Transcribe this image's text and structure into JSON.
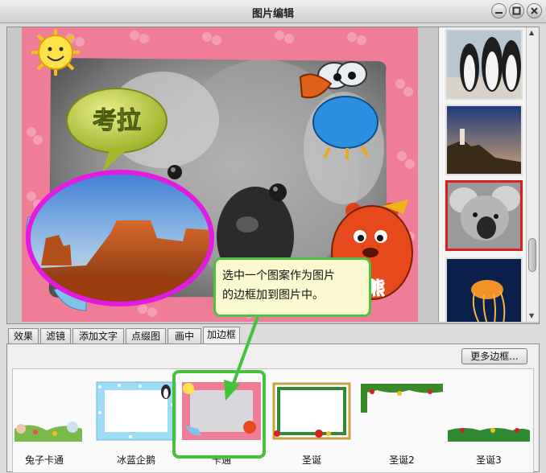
{
  "window": {
    "title": "图片编辑"
  },
  "preview": {
    "speech_text": "考拉",
    "badge_text": "熊"
  },
  "tabs": [
    {
      "label": "效果"
    },
    {
      "label": "滤镜"
    },
    {
      "label": "添加文字"
    },
    {
      "label": "点缀图"
    },
    {
      "label": "画中画"
    },
    {
      "label": "加边框"
    }
  ],
  "active_tab": "加边框",
  "panel": {
    "more_frames_label": "更多边框..."
  },
  "frames": [
    {
      "label": "兔子卡通"
    },
    {
      "label": "冰蓝企鹅"
    },
    {
      "label": "卡通"
    },
    {
      "label": "圣诞"
    },
    {
      "label": "圣诞2"
    },
    {
      "label": "圣诞3"
    }
  ],
  "callout": {
    "line1": "选中一个图案作为图片",
    "line2": "的边框加到图片中。"
  },
  "colors": {
    "callout_border": "#4ec241",
    "selected_thumb": "#e11c1c",
    "frame_pink": "#f07d98"
  },
  "icons": {
    "minimize": "minimize-icon",
    "maximize": "maximize-icon",
    "close": "close-icon"
  }
}
